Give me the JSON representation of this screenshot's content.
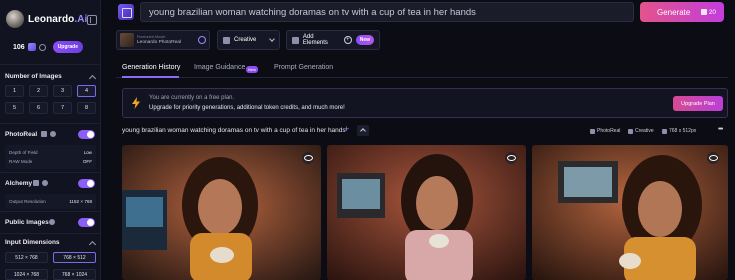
{
  "brand": {
    "name": "Leonardo",
    "suffix": ".Ai"
  },
  "tokens": {
    "count": "106",
    "upgrade_label": "Upgrade"
  },
  "sidebar": {
    "num_images_title": "Number of Images",
    "num_options": [
      "1",
      "2",
      "3",
      "4",
      "5",
      "6",
      "7",
      "8"
    ],
    "num_selected": "4",
    "photoreal": {
      "title": "PhotoReal",
      "enabled": true,
      "depth_label": "Depth of Field",
      "depth_value": "Low",
      "raw_label": "RAW Mode",
      "raw_value": "OFF"
    },
    "alchemy": {
      "title": "Alchemy",
      "enabled": true,
      "output_label": "Output Resolution",
      "output_value": "1152 × 768"
    },
    "public_images": {
      "title": "Public Images",
      "enabled": true
    },
    "input_dimensions": {
      "title": "Input Dimensions",
      "options": [
        "512 × 768",
        "768 × 512",
        "1024 × 768",
        "768 × 1024"
      ],
      "selected": "768 × 512"
    }
  },
  "prompt": {
    "text": "young brazilian woman watching doramas on tv with a cup of tea in her hands"
  },
  "generate": {
    "label": "Generate",
    "cost": "20"
  },
  "model": {
    "sub_label": "Finetuned Model",
    "name": "Leonardo PhotoReal"
  },
  "style": {
    "label": "Creative"
  },
  "elements": {
    "label": "Add Elements",
    "badge": "New"
  },
  "tabs": [
    {
      "label": "Generation History",
      "active": true
    },
    {
      "label": "Image Guidance",
      "badge": "New"
    },
    {
      "label": "Prompt Generation"
    }
  ],
  "banner": {
    "line1": "You are currently on a free plan.",
    "line2": "Upgrade for priority generations, additional token credits, and much more!",
    "button": "Upgrade Plan"
  },
  "generation": {
    "title": "young brazilian woman watching doramas on tv with a cup of tea in her hands",
    "meta_model": "PhotoReal",
    "meta_style": "Creative",
    "meta_size": "768 x 512px"
  },
  "colors": {
    "accent": "#8c6cf5",
    "generate_start": "#e3538b",
    "generate_end": "#c33ddc",
    "bolt": "#f5a524"
  }
}
